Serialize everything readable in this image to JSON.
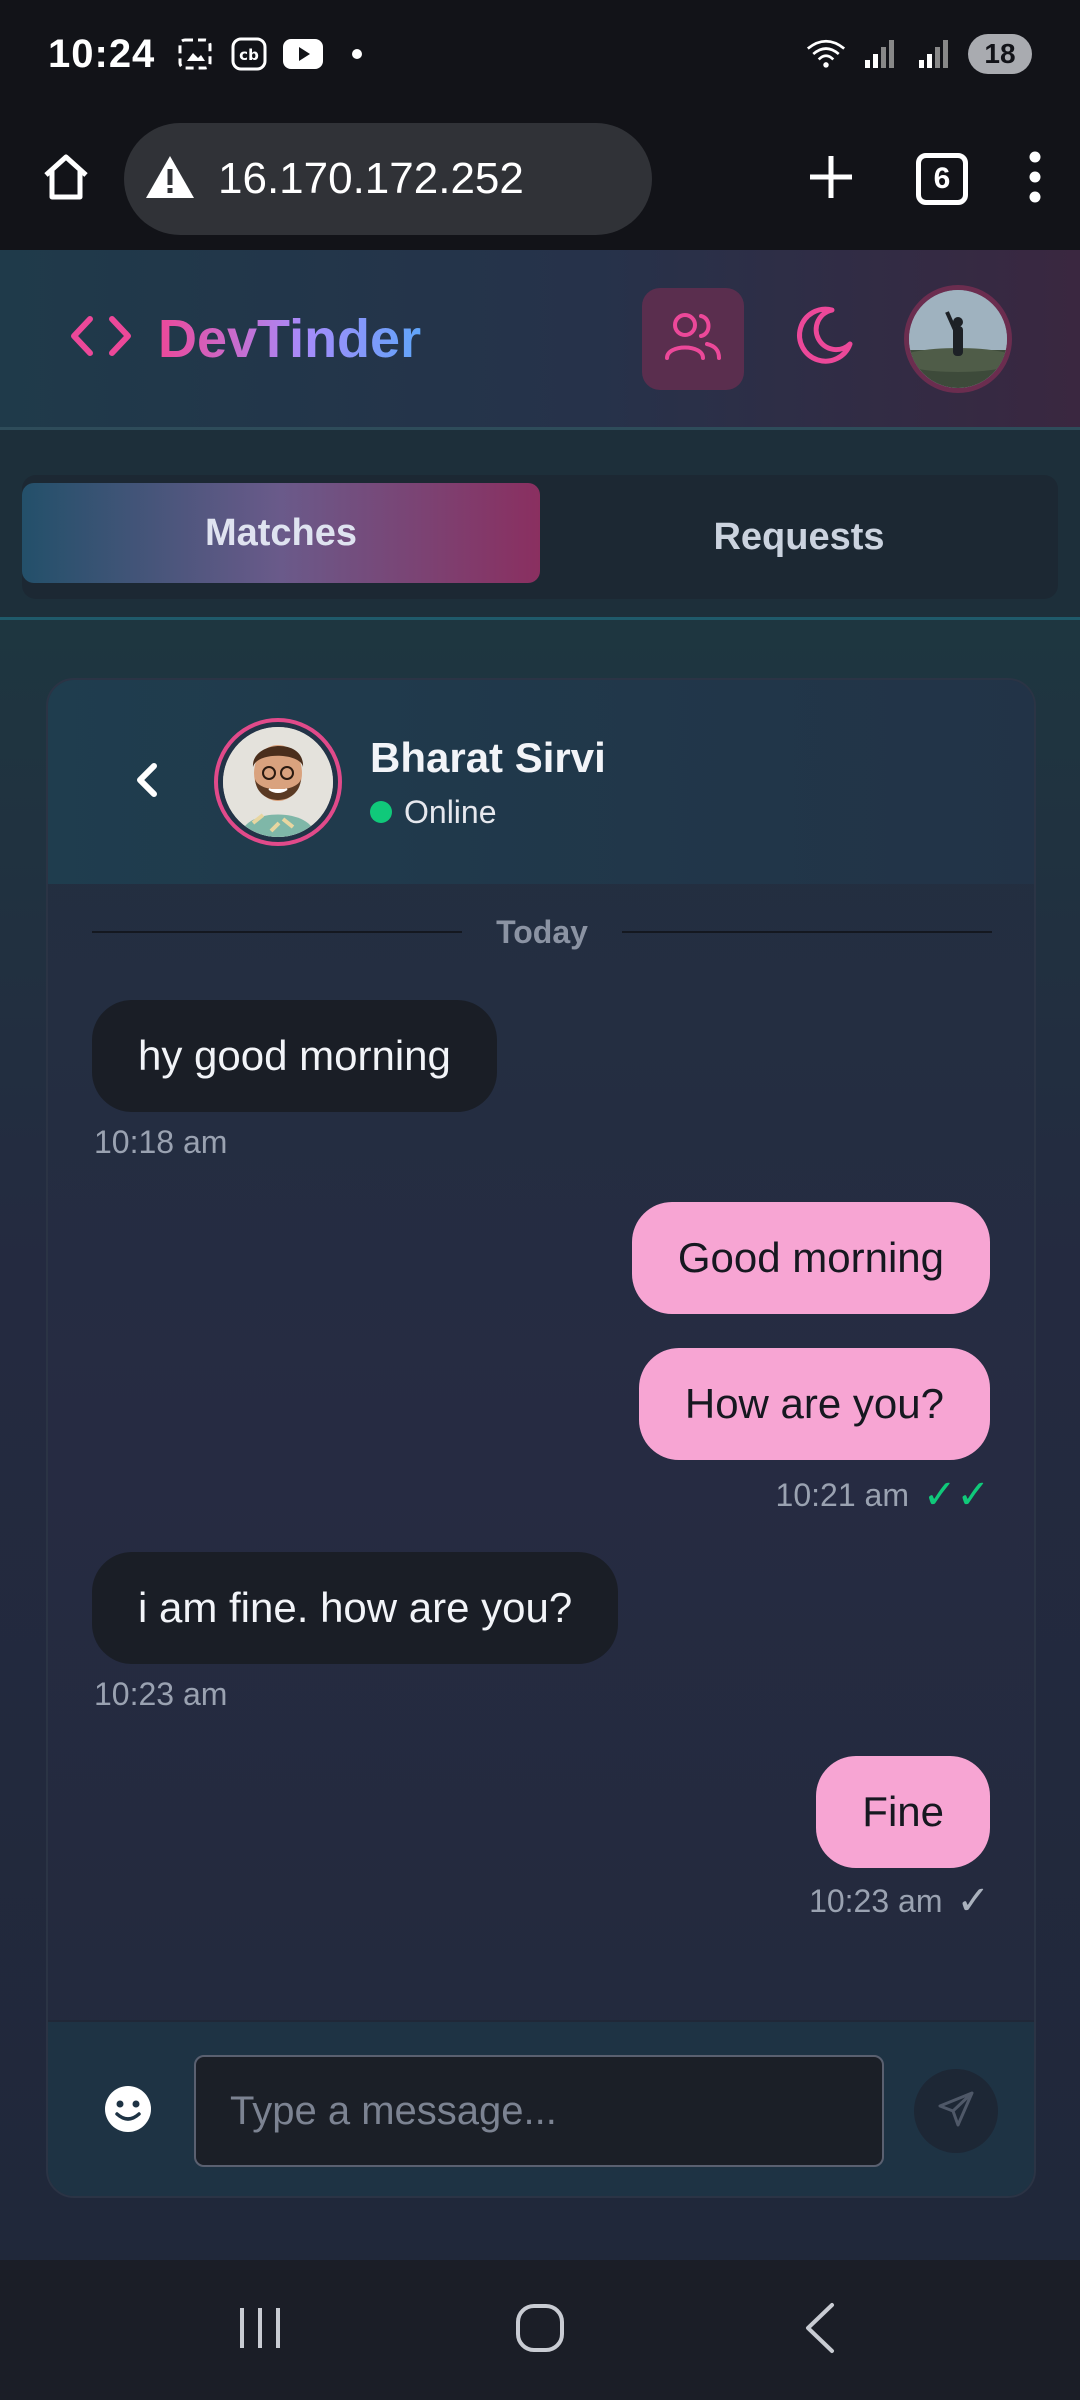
{
  "status_bar": {
    "time": "10:24",
    "battery": "18",
    "icons_left": [
      "screenshot-icon",
      "cb-app-icon",
      "youtube-icon",
      "notification-dot-icon"
    ],
    "icons_right": [
      "wifi-icon",
      "signal-icon",
      "signal-icon",
      "battery-icon"
    ]
  },
  "browser": {
    "url": "16.170.172.252",
    "tab_count": "6",
    "icons": [
      "home-icon",
      "warning-icon",
      "new-tab-icon",
      "tabs-icon",
      "more-menu-icon"
    ]
  },
  "header": {
    "brand": "DevTinder",
    "logo_icon": "code-brackets-icon",
    "connections_icon": "users-icon",
    "theme_icon": "moon-icon",
    "avatar_icon": "user-avatar"
  },
  "tabs": [
    {
      "label": "Matches",
      "active": true
    },
    {
      "label": "Requests",
      "active": false
    }
  ],
  "chat": {
    "contact_name": "Bharat Sirvi",
    "contact_status": "Online",
    "date_separator": "Today",
    "messages": [
      {
        "text": "hy good morning",
        "direction": "in",
        "time": "10:18 am"
      },
      {
        "text": "Good morning",
        "direction": "out"
      },
      {
        "text": "How are you?",
        "direction": "out",
        "time": "10:21 am",
        "receipt": "✓✓"
      },
      {
        "text": "i am fine. how are you?",
        "direction": "in",
        "time": "10:23 am"
      },
      {
        "text": "Fine",
        "direction": "out",
        "time": "10:23 am",
        "receipt": "✓"
      }
    ],
    "composer": {
      "placeholder": "Type a message...",
      "value": "",
      "emoji_icon": "smiley-icon",
      "send_icon": "send-icon"
    }
  },
  "colors": {
    "accent_pink": "#ec4899",
    "outgoing_bubble": "#f7a5d3",
    "incoming_bubble": "#1a1e26",
    "online": "#10c97a"
  }
}
